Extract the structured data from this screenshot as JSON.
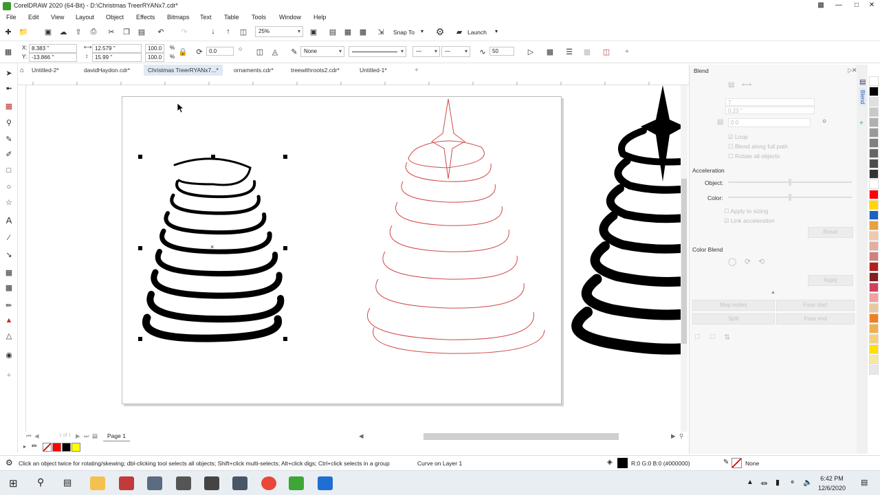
{
  "window": {
    "title": "CorelDRAW 2020 (64-Bit) - D:\\Christmas TreerRYANx7.cdr*"
  },
  "menu": [
    "File",
    "Edit",
    "View",
    "Layout",
    "Object",
    "Effects",
    "Bitmaps",
    "Text",
    "Table",
    "Tools",
    "Window",
    "Help"
  ],
  "standard": {
    "zoom": "25%",
    "snap_label": "Snap To",
    "launch_label": "Launch"
  },
  "property_bar": {
    "x": "8.383 \"",
    "y": "-13.866 \"",
    "w": "12.579 \"",
    "h": "15.99 \"",
    "scale_w": "100.0",
    "scale_h": "100.0",
    "pct": "%",
    "angle": "0.0",
    "outline": "None",
    "outline_width": "50"
  },
  "tabs": [
    "Untitled-2*",
    "davidHaydon.cdr*",
    "Christmas TreerRYANx7...*",
    "ornaments.cdr*",
    "treewithroots2.cdr*",
    "Untitled-1*"
  ],
  "active_tab": 2,
  "page_nav": {
    "page_label": "Page 1",
    "of": "1 of 1"
  },
  "status": {
    "hint": "Click an object twice for rotating/skewing; dbl-clicking tool selects all objects; Shift+click multi-selects; Alt+click digs; Ctrl+click selects in a group",
    "selection": "Curve on Layer 1",
    "fill": "R:0 G:0 B:0 (#000000)",
    "outline": "None"
  },
  "docker": {
    "title": "Blend",
    "steps": "7",
    "spacing": "0.23 \"",
    "rotation": "0.0",
    "loop": "Loop",
    "along_path": "Blend along full path",
    "rotate_all": "Rotate all objects",
    "acceleration": "Acceleration",
    "object": "Object:",
    "color": "Color:",
    "apply_sizing": "Apply to sizing",
    "link_accel": "Link acceleration",
    "reset": "Reset",
    "color_blend": "Color Blend",
    "apply": "Apply",
    "map_nodes": "Map nodes",
    "fuse_start": "Fuse start",
    "split": "Split",
    "fuse_end": "Fuse end",
    "side_tab": "Blend"
  },
  "palette": [
    "#ffffff",
    "#000000",
    "#e0e0e0",
    "#c8c8c8",
    "#b0b0b0",
    "#999999",
    "#808080",
    "#666666",
    "#4d4d4d",
    "#333333",
    "#ffffff",
    "#ff0000",
    "#ffd700",
    "#2060c0",
    "#e8a040",
    "#f0c8b0",
    "#e0b0a0",
    "#d08080",
    "#b02020",
    "#802020",
    "#d04060",
    "#f0a0a0",
    "#e8c8a0",
    "#f08020",
    "#f0b050",
    "#f5d080",
    "#ffe000",
    "#f5e8a0",
    "#e8e8e8"
  ],
  "taskbar": {
    "time": "6:42 PM",
    "date": "12/6/2020"
  }
}
